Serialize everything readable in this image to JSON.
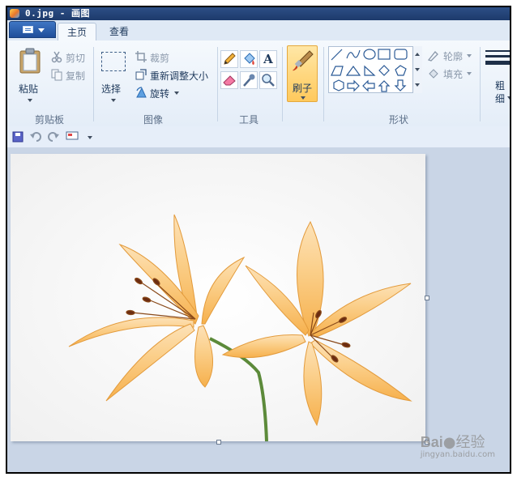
{
  "window": {
    "title": "0.jpg - 画图"
  },
  "tabs": [
    {
      "label": "主页",
      "active": true
    },
    {
      "label": "查看",
      "active": false
    }
  ],
  "clipboard": {
    "paste": "粘贴",
    "cut": "剪切",
    "copy": "复制",
    "group": "剪贴板"
  },
  "image": {
    "select": "选择",
    "crop": "裁剪",
    "resize": "重新调整大小",
    "rotate": "旋转",
    "group": "图像"
  },
  "tools": {
    "group": "工具",
    "text_tool": "A"
  },
  "brushes": {
    "label": "刷子"
  },
  "shapes": {
    "outline": "轮廓",
    "fill": "填充",
    "group": "形状"
  },
  "size": {
    "line1": "粗",
    "line2": "细"
  },
  "watermark": {
    "brand": "Bai",
    "site": "jingyan.baidu.com",
    "product": "经验"
  },
  "colors": {
    "accent": "#2c4f86",
    "ribbon": "#f5f9fd",
    "brush_active": "#ffc95c"
  },
  "icons": [
    "app-icon",
    "file-menu-icon",
    "paste-icon",
    "cut-icon",
    "copy-icon",
    "select-icon",
    "crop-icon",
    "resize-icon",
    "rotate-icon",
    "pencil-icon",
    "fill-bucket-icon",
    "text-icon",
    "eraser-icon",
    "color-picker-icon",
    "magnifier-icon",
    "brush-icon",
    "outline-icon",
    "fill-icon",
    "size-icon",
    "save-icon",
    "undo-icon",
    "redo-icon",
    "monitor-icon"
  ]
}
